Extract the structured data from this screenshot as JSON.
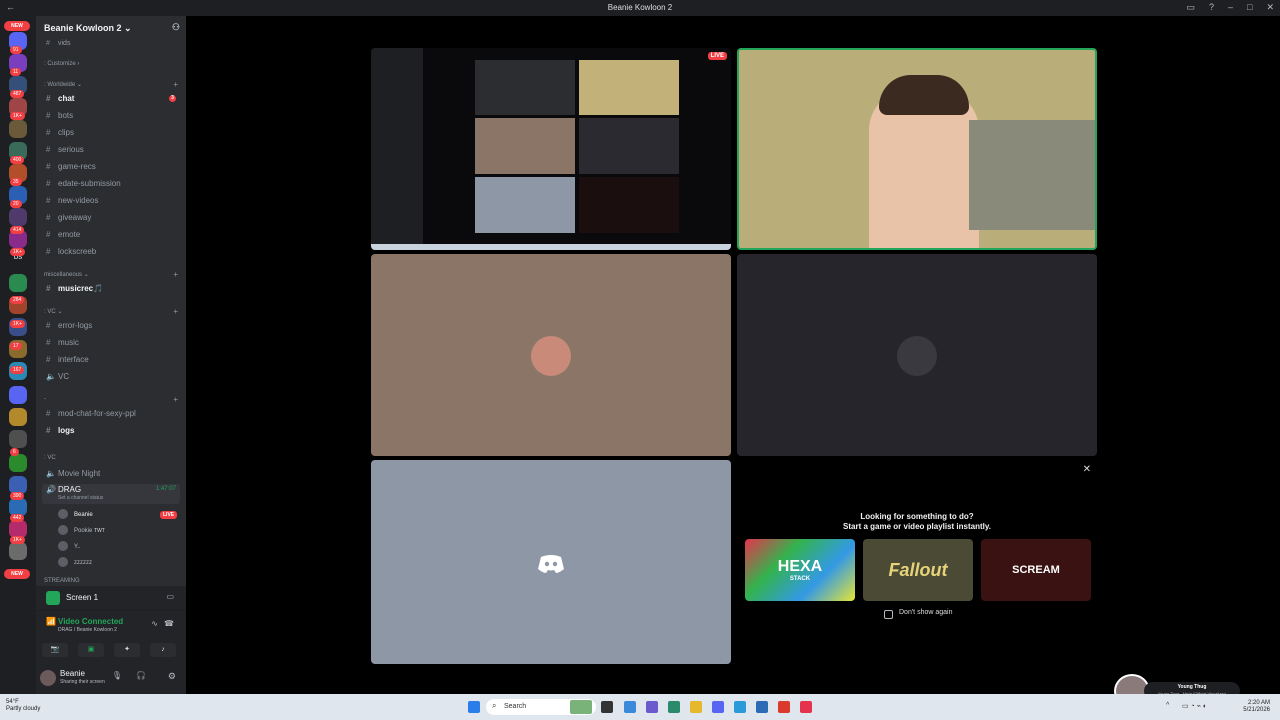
{
  "window": {
    "title": "Beanie Kowloon 2"
  },
  "guilds": {
    "badges": [
      "91",
      "11",
      "487",
      "1K+",
      "400",
      "35",
      "20",
      "414",
      "1K+",
      "284",
      "1K+",
      "17",
      "167",
      "6",
      "390",
      "442",
      "1K+"
    ],
    "new_top": "NEW",
    "new_bottom": "NEW",
    "bs_label": "bs"
  },
  "server": {
    "name": "Beanie Kowloon 2"
  },
  "channels": {
    "top_partial": "vids",
    "customize_label": ": Customize",
    "cat_worldwide": ": Worldwide",
    "cat_misc": "miscellaneous",
    "cat_vc": ": VC",
    "cat_dash": "-",
    "cat_vc2": ": VC",
    "cat_streaming": "STREAMING",
    "items": [
      {
        "name": "chat",
        "bold": true,
        "mention": "3"
      },
      {
        "name": "bots"
      },
      {
        "name": "clips"
      },
      {
        "name": "serious"
      },
      {
        "name": "game-recs"
      },
      {
        "name": "edate-submission"
      },
      {
        "name": "new-videos"
      },
      {
        "name": "giveaway"
      },
      {
        "name": "emote"
      },
      {
        "name": "lockscreeb"
      }
    ],
    "misc_items": [
      "musicrec🎵"
    ],
    "vc_items": [
      "error-logs",
      "music",
      "interface",
      "VC"
    ],
    "mod_items": [
      "mod-chat-for-sexy-ppl",
      "logs"
    ],
    "voice": {
      "movie_night": "Movie Night",
      "drag": "DRAG",
      "drag_time": "1:47:07",
      "drag_status": "Set a channel status",
      "users": [
        {
          "name": "Beanie",
          "live": "LIVE"
        },
        {
          "name": "Pookie",
          "extra": "TWT"
        },
        {
          "name": "Y.."
        },
        {
          "name": "zzzzzz"
        }
      ]
    }
  },
  "panels": {
    "screen_label": "Screen 1",
    "voice_connected": "Video Connected",
    "voice_location": "DRAG / Beanie Kowloon 2",
    "user_name": "Beanie",
    "user_status": "Sharing their screen"
  },
  "stage": {
    "live_tag": "LIVE",
    "activity_title": "Looking for something to do?",
    "activity_subtitle": "Start a game or video playlist instantly.",
    "games": [
      "HEXA",
      "Fallout",
      "SCREAM"
    ],
    "hexa_sub": "STACK",
    "dont_show": "Don't show again"
  },
  "taskbar": {
    "weather_temp": "54°F",
    "weather_desc": "Partly cloudy",
    "search_placeholder": "Search",
    "time": "2:20 AM",
    "date": "5/21/2026",
    "media_title": "Young Thug",
    "media_sub": "Young Thug - Ninja (Official Visualizer)"
  },
  "colors": {
    "accent_green": "#23a55a",
    "live_red": "#f23f43",
    "blurple": "#5865f2"
  }
}
